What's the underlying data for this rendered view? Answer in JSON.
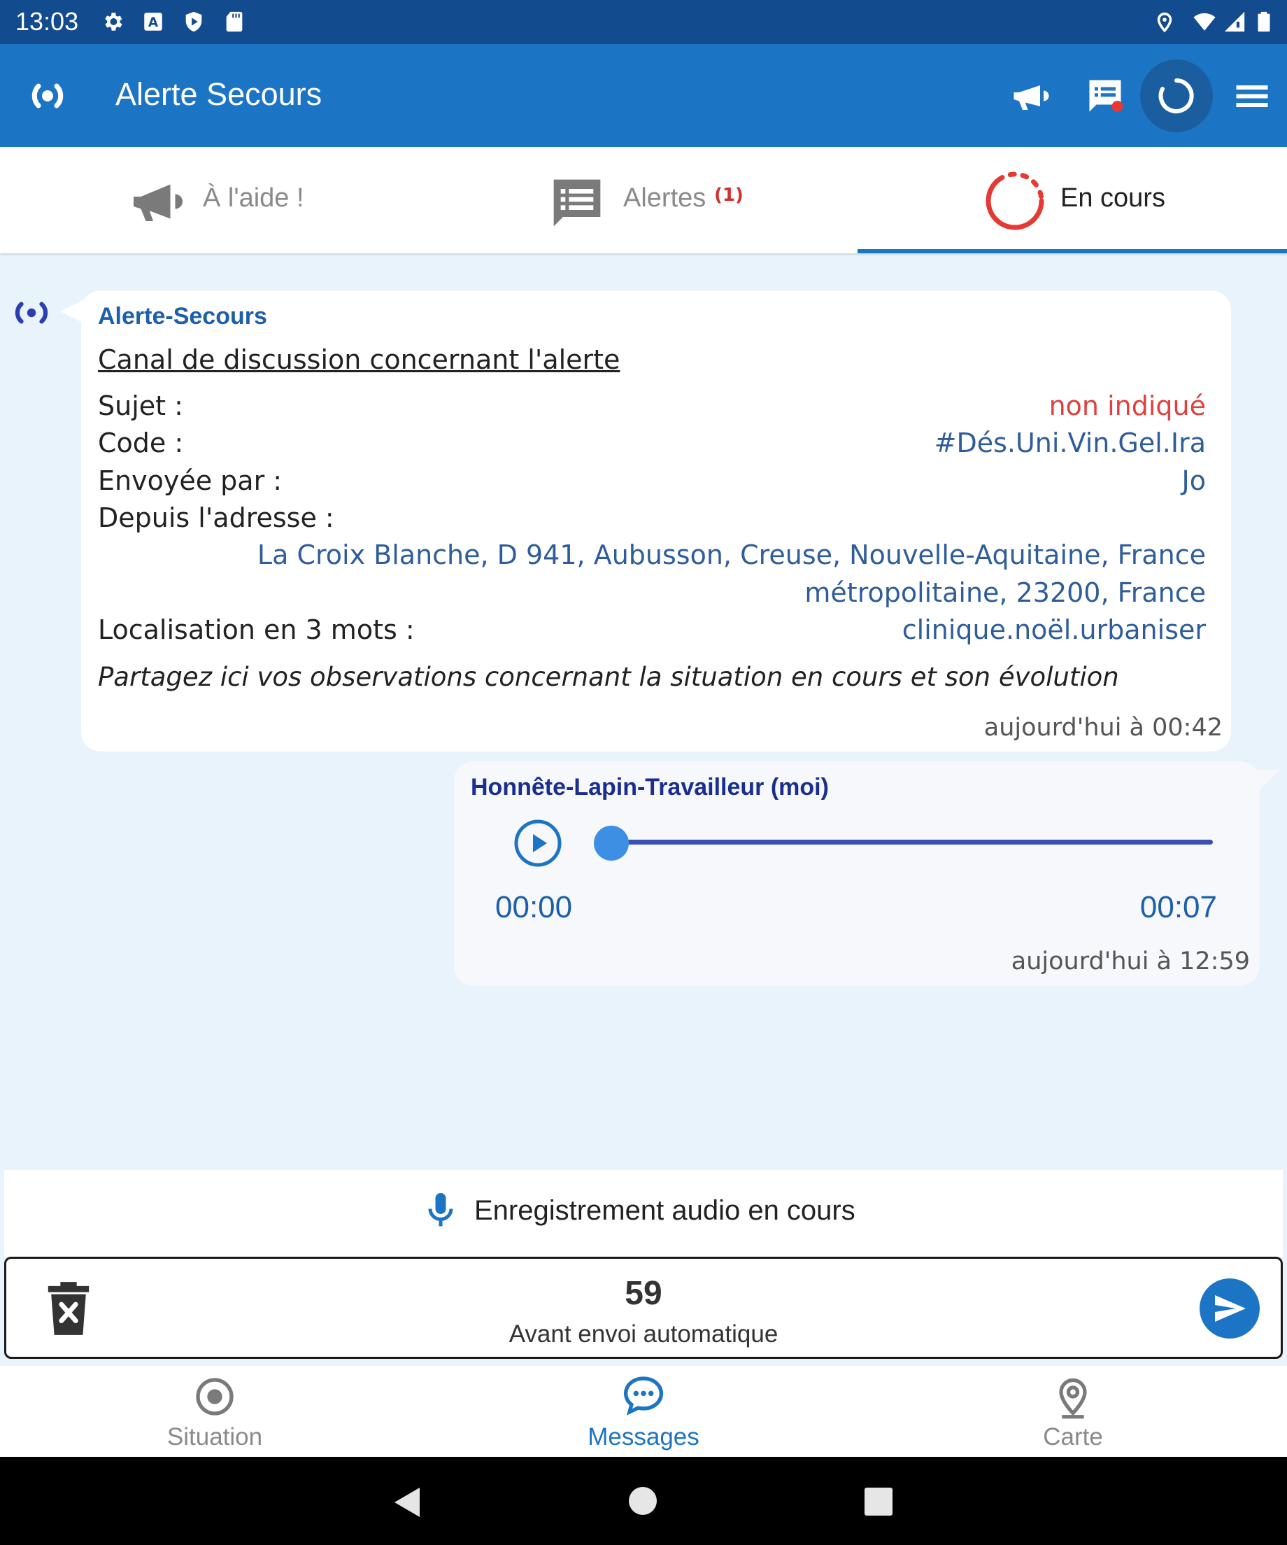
{
  "status_bar": {
    "time": "13:03"
  },
  "app_bar": {
    "title": "Alerte Secours"
  },
  "tabs": [
    {
      "label": "À l'aide !"
    },
    {
      "label": "Alertes",
      "badge": "(1)"
    },
    {
      "label": "En cours"
    }
  ],
  "messages": {
    "system": {
      "sender": "Alerte-Secours",
      "heading": "Canal de discussion concernant l'alerte",
      "rows": [
        {
          "label": "Sujet :",
          "value": "non indiqué"
        },
        {
          "label": "Code :",
          "value": "#Dés.Uni.Vin.Gel.Ira"
        },
        {
          "label": "Envoyée par :",
          "value": "Jo"
        },
        {
          "label": "Depuis l'adresse :",
          "value_line1": "La Croix Blanche, D 941, Aubusson, Creuse, Nouvelle-Aquitaine, France",
          "value_line2": "métropolitaine, 23200, France"
        },
        {
          "label": "Localisation en 3 mots :",
          "value": "clinique.noël.urbaniser"
        }
      ],
      "note": "Partagez ici vos observations concernant la situation en cours et son évolution",
      "timestamp": "aujourd'hui à 00:42"
    },
    "mine": {
      "sender": "Honnête-Lapin-Travailleur",
      "sender_suffix": "(moi)",
      "audio": {
        "current": "00:00",
        "duration": "00:07",
        "progress": 0
      },
      "timestamp": "aujourd'hui à 12:59"
    }
  },
  "recording": {
    "label": "Enregistrement audio en cours",
    "countdown": "59",
    "countdown_label": "Avant envoi automatique"
  },
  "bottom_nav": [
    {
      "label": "Situation"
    },
    {
      "label": "Messages"
    },
    {
      "label": "Carte"
    }
  ],
  "colors": {
    "primary": "#1c74c5",
    "status_bar": "#134b8f",
    "alert_red": "#d32f2f",
    "value_blue": "#2f5d9b",
    "sender_blue": "#1c5faa",
    "me_blue": "#1a2e8f",
    "chat_bg": "#e8f3fc"
  }
}
